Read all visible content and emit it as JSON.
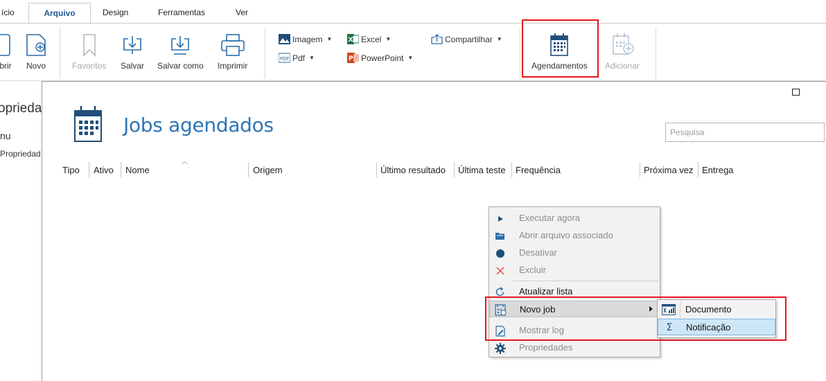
{
  "tabs": [
    "ício",
    "Arquivo",
    "Design",
    "Ferramentas",
    "Ver"
  ],
  "ribbon": {
    "buttons": {
      "abrir": "brir",
      "novo": "Novo",
      "favoritos": "Favoritos",
      "salvar": "Salvar",
      "salvar_como": "Salvar como",
      "imprimir": "Imprimir",
      "agendamentos": "Agendamentos",
      "adicionar": "Adicionar"
    },
    "export": {
      "imagem": "Imagem",
      "pdf": "Pdf",
      "excel": "Excel",
      "powerpoint": "PowerPoint",
      "compartilhar": "Compartilhar"
    }
  },
  "left_panel": {
    "title": "opriedad",
    "menu": "nu",
    "item": "Propriedad"
  },
  "dialog": {
    "title": "Jobs agendados",
    "search_placeholder": "Pesquisa",
    "columns": [
      "Tipo",
      "Ativo",
      "Nome",
      "Origem",
      "Último resultado",
      "Última teste",
      "Frequência",
      "Próxima vez",
      "Entrega"
    ]
  },
  "context_menu": {
    "items": [
      {
        "label": "Executar agora",
        "icon": "play-icon",
        "enabled": false
      },
      {
        "label": "Abrir arquivo associado",
        "icon": "open-folder-icon",
        "enabled": false
      },
      {
        "label": "Desativar",
        "icon": "dot-icon",
        "enabled": false
      },
      {
        "label": "Excluir",
        "icon": "close-icon",
        "enabled": false
      },
      {
        "label": "Atualizar lista",
        "icon": "refresh-icon",
        "enabled": true
      },
      {
        "label": "Novo job",
        "icon": "new-job-icon",
        "enabled": true,
        "has_submenu": true
      },
      {
        "label": "Mostrar log",
        "icon": "log-icon",
        "enabled": false
      },
      {
        "label": "Propriedades",
        "icon": "gear-icon",
        "enabled": false
      }
    ],
    "submenu": [
      {
        "label": "Documento",
        "icon": "document-report-icon"
      },
      {
        "label": "Notificação",
        "icon": "sigma-icon",
        "selected": true
      }
    ]
  },
  "colors": {
    "accent": "#2e75b6",
    "highlight": "#e3161c",
    "menu_bg": "#f2f2f2",
    "selected_bg": "#cde6f7"
  }
}
